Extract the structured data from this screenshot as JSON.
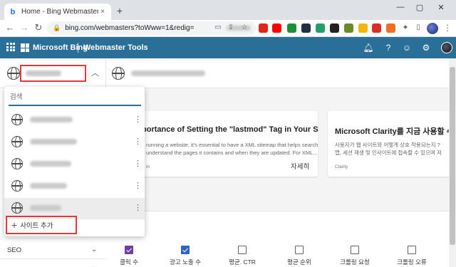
{
  "browser": {
    "tab_title": "Home - Bing Webmaster Tools",
    "tab_close": "×",
    "new_tab": "+",
    "url": "bing.com/webmasters?toWww=1&redig=",
    "win_min": "—",
    "win_max": "▢",
    "win_close": "✕",
    "extensions": [
      {
        "name": "opera-icon",
        "color": "#e1251b"
      },
      {
        "name": "youtube-icon",
        "color": "#ff0000"
      },
      {
        "name": "ext-green-icon",
        "color": "#1b8f3a"
      },
      {
        "name": "ext-dark-icon",
        "color": "#203040"
      },
      {
        "name": "ext-green2-icon",
        "color": "#22a06b"
      },
      {
        "name": "ext-black-icon",
        "color": "#222222"
      },
      {
        "name": "ext-olive-icon",
        "color": "#6c8a2a"
      },
      {
        "name": "ext-yellow-icon",
        "color": "#f2b705"
      },
      {
        "name": "ext-red-icon",
        "color": "#d93025"
      },
      {
        "name": "ext-orange-icon",
        "color": "#f26d21"
      }
    ]
  },
  "appbar": {
    "brand": "Microsoft Bing",
    "product": "Webmaster Tools"
  },
  "dropdown": {
    "search_placeholder": "검색",
    "items": [
      {
        "width": 60,
        "active": false
      },
      {
        "width": 66,
        "active": false
      },
      {
        "width": 58,
        "active": false
      },
      {
        "width": 52,
        "active": false
      },
      {
        "width": 44,
        "active": true
      }
    ],
    "add_site_label": "사이트 추가"
  },
  "cards": [
    {
      "title": "portance of Setting the \"lastmod\" Tag in Your Sitemap",
      "body_line1": "running a website, it's essential to have a XML sitemap that helps search",
      "body_line2": "understand the pages it contains and when they are updated. For XML...",
      "source": "m",
      "more": "자세히"
    },
    {
      "title": "Microsoft Clarity를 지금 사용할 수 있습니다",
      "body_line1": "사용자가 웹 사이트와 어떻게 상호 작용되는지 ?",
      "body_line2": "맵, 세션 재생 및 인사이트에 접속할 수 있으며 저",
      "source": "Clarity"
    }
  ],
  "leftnav": {
    "seo": "SEO",
    "chevron": "⌄"
  },
  "metrics": [
    {
      "label": "클릭 수",
      "checked": true,
      "color": "#6b3fa0"
    },
    {
      "label": "광고 노출 수",
      "checked": true,
      "color": "#2f63c8"
    },
    {
      "label": "평균. CTR",
      "checked": false
    },
    {
      "label": "평균 순위",
      "checked": false
    },
    {
      "label": "크롤링 요청",
      "checked": false
    },
    {
      "label": "크롤링 오류",
      "checked": false
    }
  ]
}
